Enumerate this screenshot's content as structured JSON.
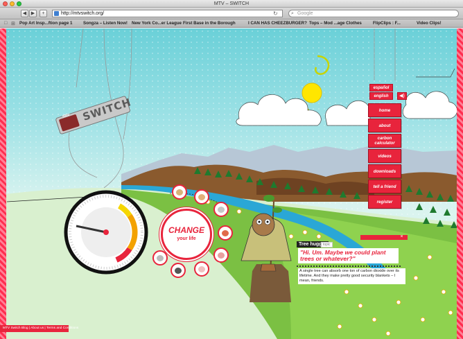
{
  "window": {
    "title": "MTV – SWITCH",
    "traffic_lights": {
      "close": "#ff5f57",
      "minimize": "#febc2e",
      "zoom": "#28c840"
    }
  },
  "toolbar": {
    "back_icon": "◀",
    "forward_icon": "▶",
    "add_icon": "+",
    "url": "http://mtvswitch.org/",
    "reload_icon": "↻",
    "search_placeholder": "Google",
    "search_icon": "⌕"
  },
  "bookmarks": {
    "icons": [
      "□",
      "⊞"
    ],
    "items": [
      "Pop Art Insp...ftion page 1",
      "Songza – Listen Now!",
      "New York Co...er League",
      "First Base in the Borough",
      "I CAN HAS CHEEZBURGER?",
      "Tops – Mod ...age Clothes",
      "FlipClips : F...",
      "Video Clips!"
    ]
  },
  "site": {
    "logo_text": "SWITCH",
    "logo_badge": "mtv",
    "language": {
      "spanish": "español",
      "english": "english",
      "sound_icon": "◀)"
    },
    "nav": [
      {
        "label": "home"
      },
      {
        "label": "about"
      },
      {
        "label": "carbon calculator"
      },
      {
        "label": "videos"
      },
      {
        "label": "downloads"
      },
      {
        "label": "tell a friend"
      },
      {
        "label": "register"
      }
    ],
    "change": {
      "title": "CHANGE",
      "subtitle": "your life"
    },
    "info": {
      "title": "Tree hugger",
      "badge": "topic",
      "quote": "\"Hi. Um. Maybe we could plant trees or whatever?\"",
      "text": "A single tree can absorb one ton of carbon dioxide over its lifetime. And they make pretty good security blankets – I mean, friends.",
      "close_icon": "×"
    },
    "footer": "MTV Switch Blog | About us | Terms and Conditions"
  },
  "colors": {
    "accent": "#e8243c",
    "sky": "#6ad0d8",
    "grass": "#7bc043",
    "river": "#2aa7d6"
  }
}
